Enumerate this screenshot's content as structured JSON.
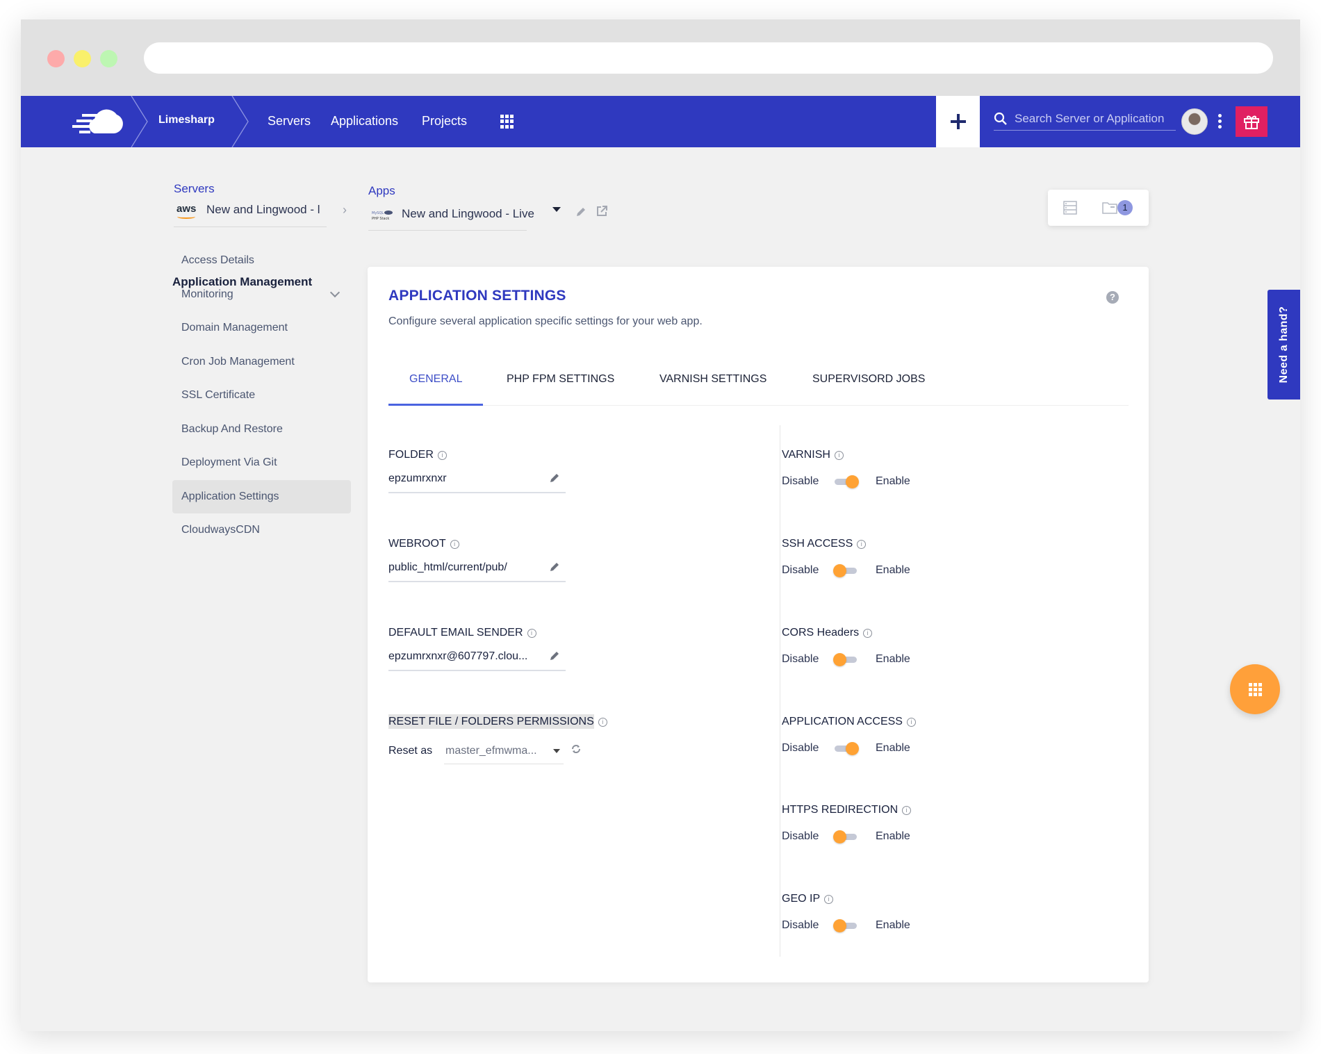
{
  "nav": {
    "org": "Limesharp",
    "links": [
      "Servers",
      "Applications",
      "Projects"
    ],
    "search_placeholder": "Search Server or Application",
    "colors": {
      "primary": "#2f39bf",
      "gift": "#e02062",
      "accent": "#ffa234"
    }
  },
  "breadcrumb": {
    "servers_label": "Servers",
    "server_provider": "aws",
    "server_name": "New and Lingwood - l",
    "apps_label": "Apps",
    "app_stack": "MySQL PHP Stack",
    "app_name": "New and Lingwood - Live"
  },
  "tools": {
    "files_badge": "1"
  },
  "sidebar": {
    "heading": "Application Management",
    "items": [
      {
        "label": "Access Details"
      },
      {
        "label": "Monitoring"
      },
      {
        "label": "Domain Management"
      },
      {
        "label": "Cron Job Management"
      },
      {
        "label": "SSL Certificate"
      },
      {
        "label": "Backup And Restore"
      },
      {
        "label": "Deployment Via Git"
      },
      {
        "label": "Application Settings"
      },
      {
        "label": "CloudwaysCDN"
      }
    ],
    "active": "Application Settings"
  },
  "card": {
    "title": "APPLICATION SETTINGS",
    "description": "Configure several application specific settings for your web app.",
    "help": "?",
    "tabs": [
      "GENERAL",
      "PHP FPM SETTINGS",
      "VARNISH SETTINGS",
      "SUPERVISORD JOBS"
    ],
    "active_tab": "GENERAL"
  },
  "fields": {
    "folder": {
      "label": "FOLDER",
      "value": "epzumrxnxr"
    },
    "webroot": {
      "label": "WEBROOT",
      "value": "public_html/current/pub/"
    },
    "email": {
      "label": "DEFAULT EMAIL SENDER",
      "value": "epzumrxnxr@607797.clou..."
    },
    "reset": {
      "label": "RESET FILE / FOLDERS PERMISSIONS",
      "prefix": "Reset as",
      "value": "master_efmwma..."
    }
  },
  "toggles": {
    "disable_label": "Disable",
    "enable_label": "Enable",
    "items": [
      {
        "label": "VARNISH",
        "enabled": true
      },
      {
        "label": "SSH ACCESS",
        "enabled": false
      },
      {
        "label": "CORS Headers",
        "enabled": false
      },
      {
        "label": "APPLICATION ACCESS",
        "enabled": true
      },
      {
        "label": "HTTPS REDIRECTION",
        "enabled": false
      },
      {
        "label": "GEO IP",
        "enabled": false
      }
    ]
  },
  "help_tab": "Need a hand?"
}
